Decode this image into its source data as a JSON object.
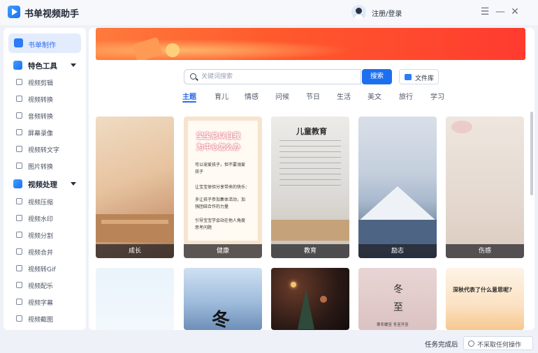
{
  "app": {
    "title": "书单视频助手"
  },
  "header": {
    "login": "注册/登录"
  },
  "window_controls": {
    "menu": "☰",
    "minimize": "—",
    "close": "✕"
  },
  "sidebar": {
    "active": {
      "label": "书单制作",
      "icon": "booklist-icon"
    },
    "sections": [
      {
        "label": "特色工具",
        "items": [
          {
            "label": "视频剪辑",
            "icon": "crop-icon"
          },
          {
            "label": "视频转换",
            "icon": "video-convert-icon"
          },
          {
            "label": "音频转换",
            "icon": "audio-icon"
          },
          {
            "label": "屏幕录像",
            "icon": "record-icon"
          },
          {
            "label": "视频转文字",
            "icon": "text-icon"
          },
          {
            "label": "图片转换",
            "icon": "image-icon"
          }
        ]
      },
      {
        "label": "视频处理",
        "items": [
          {
            "label": "视频压缩",
            "icon": "compress-icon"
          },
          {
            "label": "视频水印",
            "icon": "watermark-icon"
          },
          {
            "label": "视频分割",
            "icon": "split-icon"
          },
          {
            "label": "视频合并",
            "icon": "merge-icon"
          },
          {
            "label": "视频转Gif",
            "icon": "gif-icon"
          },
          {
            "label": "视频配乐",
            "icon": "music-icon"
          },
          {
            "label": "视频字幕",
            "icon": "subtitle-icon"
          },
          {
            "label": "视频截图",
            "icon": "screenshot-icon"
          }
        ]
      }
    ]
  },
  "search": {
    "placeholder": "关键词搜索",
    "button": "搜索",
    "file_library": "文件库"
  },
  "tabs": [
    "主题",
    "育儿",
    "情感",
    "问候",
    "节日",
    "生活",
    "美文",
    "旅行",
    "学习"
  ],
  "active_tab": "主题",
  "templates": [
    {
      "caption": "成长",
      "theme": "warm-room"
    },
    {
      "caption": "健康",
      "theme": "notebook",
      "text": [
        "宝宝总以自我",
        "为中心怎么办",
        "可以宠爱孩子，但不要溺爱",
        "孩子",
        "让宝宝体验分享带来的快乐：",
        "多让孩子参加集体活动，加",
        "强团结合作的力量",
        "引导宝宝学会站在他人角度",
        "思考问题"
      ]
    },
    {
      "caption": "教育",
      "theme": "desk",
      "text": [
        "儿童教育"
      ]
    },
    {
      "caption": "励志",
      "theme": "snow-mountain"
    },
    {
      "caption": "伤感",
      "theme": "blossom"
    },
    {
      "caption": "",
      "theme": "pale-blue"
    },
    {
      "caption": "",
      "theme": "winter-trees",
      "text": [
        "冬"
      ]
    },
    {
      "caption": "",
      "theme": "night-bokeh"
    },
    {
      "caption": "",
      "theme": "pink-winter",
      "text": [
        "冬",
        "至",
        "寒冬暖至  冬至开至"
      ]
    },
    {
      "caption": "",
      "theme": "autumn",
      "text": [
        "深秋代表了什么意思呢?"
      ]
    }
  ],
  "status": {
    "label": "任务完成后",
    "select": "不采取任何操作"
  }
}
